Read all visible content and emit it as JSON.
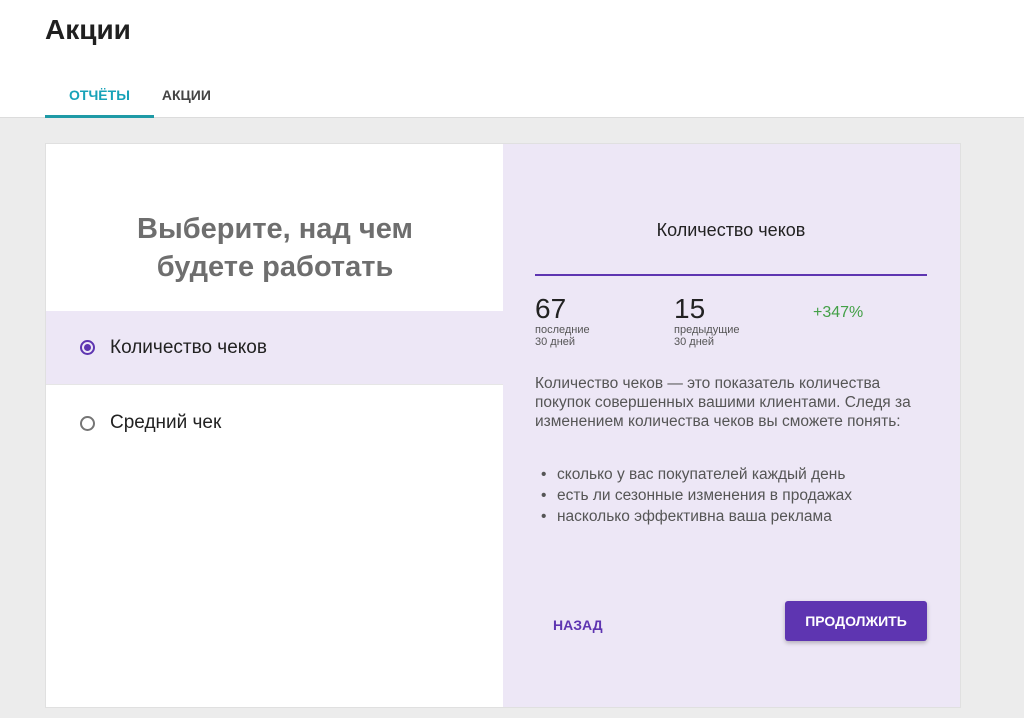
{
  "page": {
    "title": "Акции"
  },
  "tabs": [
    {
      "label": "Отчёты",
      "active": true
    },
    {
      "label": "Акции",
      "active": false
    }
  ],
  "left": {
    "title": "Выберите, над чем будете работать",
    "options": [
      {
        "label": "Количество чеков",
        "selected": true
      },
      {
        "label": "Средний чек",
        "selected": false
      }
    ]
  },
  "detail": {
    "title": "Количество чеков",
    "current": {
      "value": "67",
      "label_line1": "последние",
      "label_line2": "30 дней"
    },
    "previous": {
      "value": "15",
      "label_line1": "предыдущие",
      "label_line2": "30 дней"
    },
    "growth": "+347%",
    "description": "Количество чеков — это показатель количества покупок совершенных вашими клиентами. Следя за изменением количества чеков вы сможете понять:",
    "bullets": [
      "сколько у вас покупателей каждый день",
      "есть ли сезонные изменения в продажах",
      "насколько эффективна ваша реклама"
    ],
    "back_label": "Назад",
    "continue_label": "Продолжить"
  },
  "colors": {
    "accent": "#5e35b1",
    "tab_active": "#17a2b8",
    "selected_bg": "#ede7f6",
    "growth": "#43a047"
  },
  "icons": {
    "radio_selected": "radio-checked-icon",
    "radio_unselected": "radio-unchecked-icon"
  }
}
